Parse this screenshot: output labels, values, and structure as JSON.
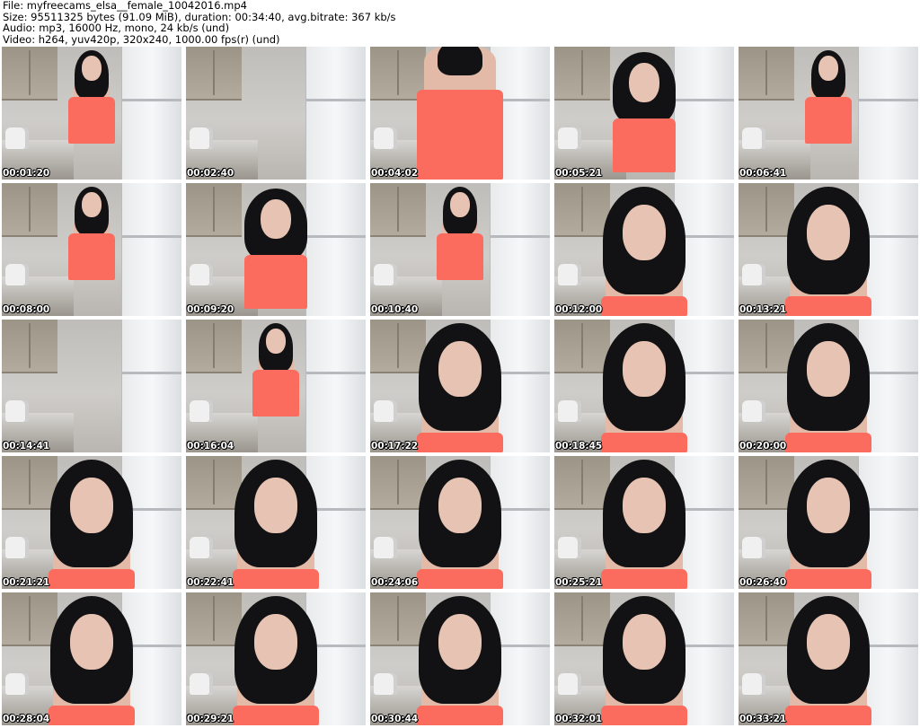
{
  "header": {
    "file_line": "File: myfreecams_elsa__female_10042016.mp4",
    "size_line": "Size: 95511325 bytes (91.09 MiB), duration: 00:34:40, avg.bitrate: 367 kb/s",
    "audio_line": "Audio: mp3, 16000 Hz, mono, 24 kb/s (und)",
    "video_line": "Video: h264, yuv420p, 320x240, 1000.00 fps(r) (und)"
  },
  "thumbnails": [
    {
      "timestamp": "00:01:20",
      "shot": "wide"
    },
    {
      "timestamp": "00:02:40",
      "shot": "empty"
    },
    {
      "timestamp": "00:04:02",
      "shot": "torso"
    },
    {
      "timestamp": "00:05:21",
      "shot": "medium"
    },
    {
      "timestamp": "00:06:41",
      "shot": "wide"
    },
    {
      "timestamp": "00:08:00",
      "shot": "wide"
    },
    {
      "timestamp": "00:09:20",
      "shot": "medium"
    },
    {
      "timestamp": "00:10:40",
      "shot": "wide"
    },
    {
      "timestamp": "00:12:00",
      "shot": "close"
    },
    {
      "timestamp": "00:13:21",
      "shot": "close"
    },
    {
      "timestamp": "00:14:41",
      "shot": "empty"
    },
    {
      "timestamp": "00:16:04",
      "shot": "wide"
    },
    {
      "timestamp": "00:17:22",
      "shot": "close"
    },
    {
      "timestamp": "00:18:45",
      "shot": "close"
    },
    {
      "timestamp": "00:20:00",
      "shot": "close"
    },
    {
      "timestamp": "00:21:21",
      "shot": "close"
    },
    {
      "timestamp": "00:22:41",
      "shot": "close"
    },
    {
      "timestamp": "00:24:06",
      "shot": "close"
    },
    {
      "timestamp": "00:25:21",
      "shot": "close"
    },
    {
      "timestamp": "00:26:40",
      "shot": "close"
    },
    {
      "timestamp": "00:28:04",
      "shot": "close"
    },
    {
      "timestamp": "00:29:21",
      "shot": "close"
    },
    {
      "timestamp": "00:30:44",
      "shot": "close"
    },
    {
      "timestamp": "00:32:01",
      "shot": "close"
    },
    {
      "timestamp": "00:33:21",
      "shot": "close"
    }
  ],
  "colors": {
    "background": "#ffffff",
    "header_text": "#000000",
    "timestamp_text": "#ffffff",
    "timestamp_outline": "#000000",
    "top_garment": "#fb6b5e",
    "hair": "#121214"
  }
}
